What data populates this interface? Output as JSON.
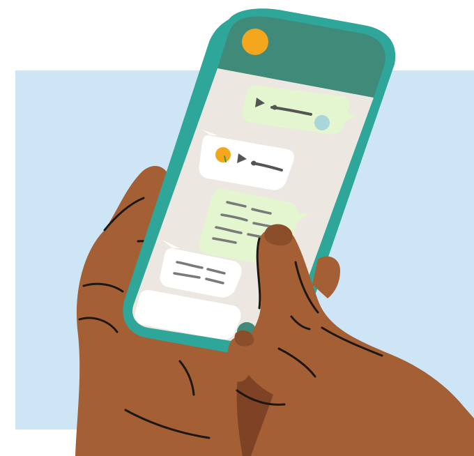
{
  "illustration": {
    "subject": "hands-holding-phone-with-chat",
    "colors": {
      "background_panel": "#cde5f5",
      "phone_body": "#2fa69a",
      "phone_header": "#3f8a78",
      "screen": "#ece7e1",
      "avatar": "#f4a61d",
      "sent_bubble": "#e4f6cf",
      "received_bubble": "#ffffff",
      "voice_line": "#555555",
      "voice_avatar_blue": "#a9d6d8",
      "skin": "#a45f35",
      "skin_shadow": "#7d4324",
      "nail": "#8a4e2b",
      "outline": "#1d1712"
    },
    "messages": [
      {
        "type": "voice-note",
        "direction": "sent"
      },
      {
        "type": "voice-note",
        "direction": "received"
      },
      {
        "type": "text-scribble",
        "direction": "sent"
      },
      {
        "type": "text-scribble",
        "direction": "received"
      }
    ],
    "composer": {
      "send_icon": "circle-send-icon"
    }
  }
}
